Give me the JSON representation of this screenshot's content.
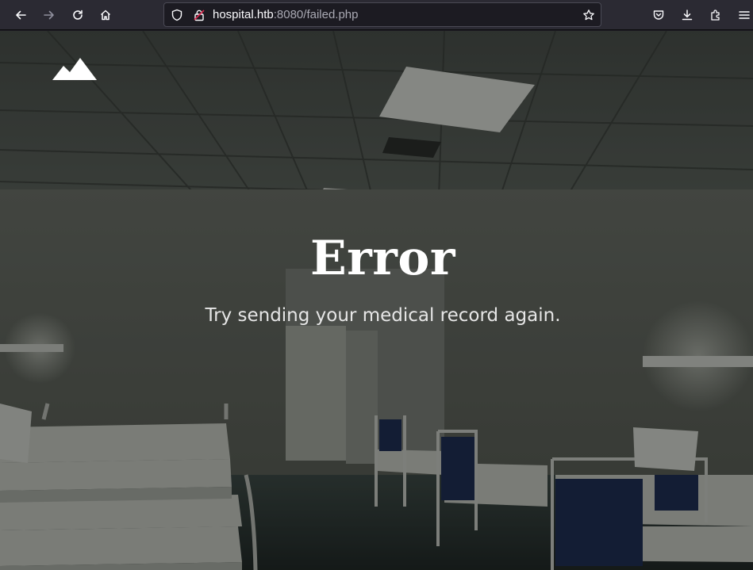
{
  "browser": {
    "url_host": "hospital.htb",
    "url_rest": ":8080/failed.php",
    "icons": {
      "back": "back-arrow-icon",
      "forward": "forward-arrow-icon",
      "reload": "reload-icon",
      "home": "home-icon",
      "shield": "tracking-protection-shield-icon",
      "insecure": "insecure-connection-lock-icon",
      "bookmark": "bookmark-star-icon",
      "pocket": "pocket-icon",
      "downloads": "download-icon",
      "extensions": "extensions-puzzle-icon",
      "menu": "hamburger-menu-icon"
    }
  },
  "page": {
    "logo": "mountain-logo-icon",
    "title": "Error",
    "message": "Try sending your medical record again."
  },
  "colors": {
    "toolbar_bg": "#2b2a33",
    "urlbar_bg": "#1c1b22",
    "insecure_accent": "#e22850",
    "title_text": "#ffffff",
    "message_text": "#e6e6e6"
  }
}
